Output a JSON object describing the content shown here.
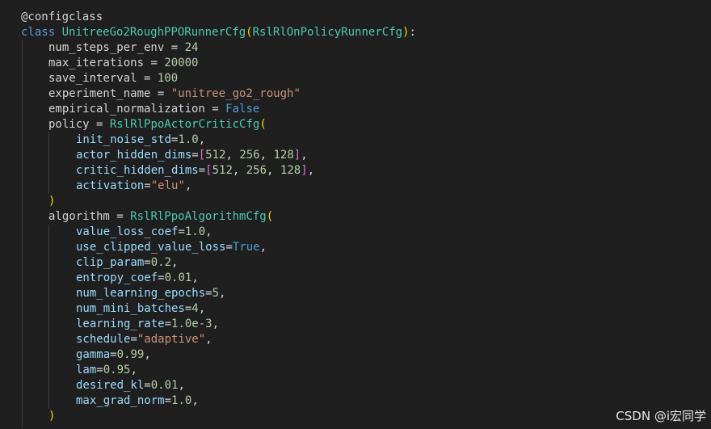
{
  "code": {
    "decorator": "@configclass",
    "class_keyword": "class",
    "class_name": "UnitreeGo2RoughPPORunnerCfg",
    "base_class": "RslRlOnPolicyRunnerCfg",
    "num_steps_per_env": {
      "name": "num_steps_per_env",
      "value": "24"
    },
    "max_iterations": {
      "name": "max_iterations",
      "value": "20000"
    },
    "save_interval": {
      "name": "save_interval",
      "value": "100"
    },
    "experiment_name": {
      "name": "experiment_name",
      "value": "\"unitree_go2_rough\""
    },
    "empirical_normalization": {
      "name": "empirical_normalization",
      "value": "False"
    },
    "policy": {
      "name": "policy",
      "cls": "RslRlPpoActorCriticCfg",
      "init_noise_std": {
        "name": "init_noise_std",
        "value": "1.0"
      },
      "actor_hidden_dims": {
        "name": "actor_hidden_dims",
        "values": [
          "512",
          "256",
          "128"
        ]
      },
      "critic_hidden_dims": {
        "name": "critic_hidden_dims",
        "values": [
          "512",
          "256",
          "128"
        ]
      },
      "activation": {
        "name": "activation",
        "value": "\"elu\""
      }
    },
    "algorithm": {
      "name": "algorithm",
      "cls": "RslRlPpoAlgorithmCfg",
      "value_loss_coef": {
        "name": "value_loss_coef",
        "value": "1.0"
      },
      "use_clipped_value_loss": {
        "name": "use_clipped_value_loss",
        "value": "True"
      },
      "clip_param": {
        "name": "clip_param",
        "value": "0.2"
      },
      "entropy_coef": {
        "name": "entropy_coef",
        "value": "0.01"
      },
      "num_learning_epochs": {
        "name": "num_learning_epochs",
        "value": "5"
      },
      "num_mini_batches": {
        "name": "num_mini_batches",
        "value": "4"
      },
      "learning_rate": {
        "name": "learning_rate",
        "value": "1.0e-3"
      },
      "schedule": {
        "name": "schedule",
        "value": "\"adaptive\""
      },
      "gamma": {
        "name": "gamma",
        "value": "0.99"
      },
      "lam": {
        "name": "lam",
        "value": "0.95"
      },
      "desired_kl": {
        "name": "desired_kl",
        "value": "0.01"
      },
      "max_grad_norm": {
        "name": "max_grad_norm",
        "value": "1.0"
      }
    }
  },
  "watermark": "CSDN @i宏同学",
  "colors": {
    "background": "#1f1f1f",
    "keyword": "#569cd6",
    "class_name": "#4ec9b0",
    "variable": "#9cdcfe",
    "number": "#b5cea8",
    "string": "#ce9178",
    "bracket_level1": "#ffd700",
    "bracket_level2": "#da70d6"
  }
}
